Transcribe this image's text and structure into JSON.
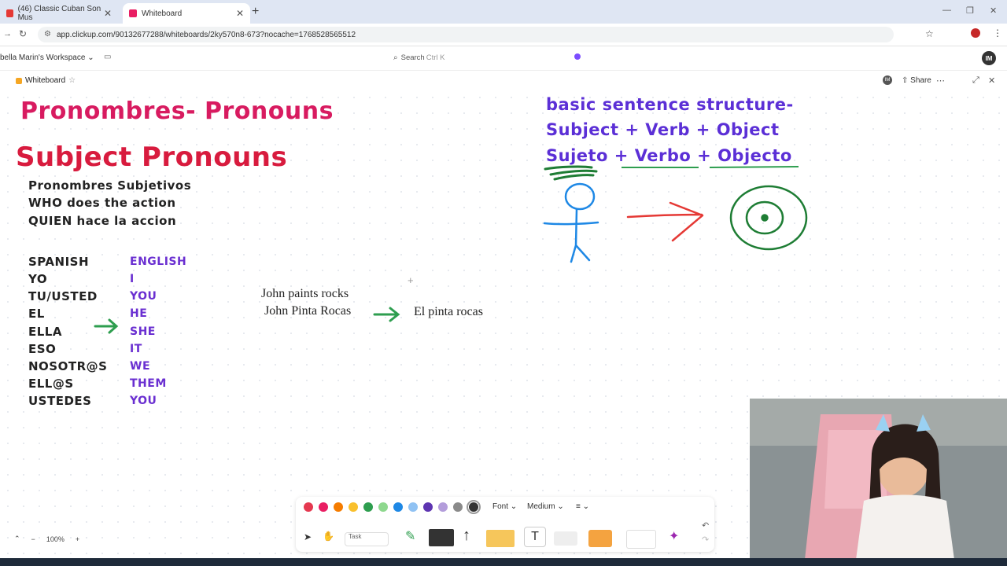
{
  "browser": {
    "tabs": [
      {
        "label": "(46) Classic Cuban Son Mus",
        "active": false
      },
      {
        "label": "Whiteboard",
        "active": true
      }
    ],
    "url": "app.clickup.com/90132677288/whiteboards/2ky570n8-673?nocache=1768528565512"
  },
  "app": {
    "workspace": "bella Marin's Workspace",
    "search_placeholder": "Search",
    "search_shortcut": "Ctrl K",
    "avatar_initials": "IM",
    "whiteboard_title": "Whiteboard",
    "share_label": "Share"
  },
  "board": {
    "title1": "Pronombres- Pronouns",
    "title2": "Subject Pronouns",
    "intro_lines": [
      "Pronombres Subjetivos",
      "WHO does the action",
      "QUIEN hace la accion"
    ],
    "spanish_header": "SPANISH",
    "english_header": "ENGLISH",
    "spanish": [
      "YO",
      "TU/USTED",
      "EL",
      "ELLA",
      "ESO",
      "NOSOTR@S",
      "ELL@S",
      "USTEDES"
    ],
    "english": [
      "I",
      "YOU",
      "HE",
      "SHE",
      "IT",
      "WE",
      "THEM",
      "YOU"
    ],
    "example_en": "John paints rocks",
    "example_es": "John Pinta Rocas",
    "example_result": "El pinta rocas",
    "structure": [
      "basic sentence structure-",
      "Subject + Verb + Object",
      "Sujeto + Verbo + Objecto"
    ]
  },
  "toolbar": {
    "colors": [
      "#e53950",
      "#e91e63",
      "#f57c00",
      "#f9c02d",
      "#2e9e4f",
      "#8ed88e",
      "#1e88e5",
      "#90c2f3",
      "#5e35b1",
      "#b39ddb",
      "#8a8a8a",
      "#333333"
    ],
    "font_label": "Font",
    "size_label": "Medium",
    "task_label": "Task",
    "text_tool": "T"
  },
  "zoom": {
    "value": "100%"
  }
}
